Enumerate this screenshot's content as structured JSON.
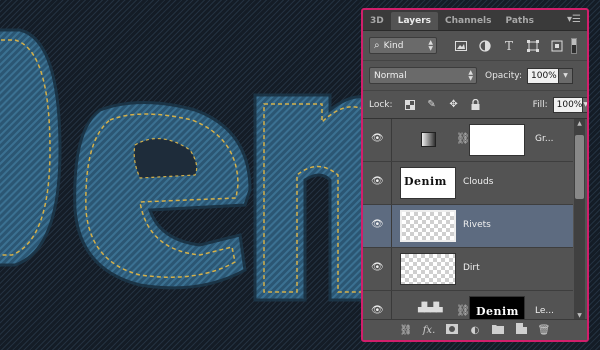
{
  "tabs": [
    {
      "label": "3D",
      "active": false
    },
    {
      "label": "Layers",
      "active": true
    },
    {
      "label": "Channels",
      "active": false
    },
    {
      "label": "Paths",
      "active": false
    }
  ],
  "filter": {
    "kind_label": "Kind",
    "icons": [
      "image-filter-icon",
      "adjustment-filter-icon",
      "type-filter-icon",
      "shape-filter-icon",
      "smart-object-filter-icon"
    ]
  },
  "blend": {
    "mode": "Normal",
    "opacity_label": "Opacity:",
    "opacity_value": "100%"
  },
  "lock": {
    "label": "Lock:",
    "fill_label": "Fill:",
    "fill_value": "100%"
  },
  "layers": [
    {
      "name": "Gr...",
      "type": "adjustment",
      "selected": false
    },
    {
      "name": "Clouds",
      "type": "image",
      "thumb_text": "Denim",
      "selected": false
    },
    {
      "name": "Rivets",
      "type": "empty",
      "selected": true
    },
    {
      "name": "Dirt",
      "type": "empty",
      "selected": false
    },
    {
      "name": "Le...",
      "type": "masked",
      "mask_text": "Denim",
      "selected": false
    }
  ],
  "bottom_icons": [
    "link-layers-icon",
    "fx-icon",
    "add-mask-icon",
    "new-adjustment-icon",
    "new-group-icon",
    "new-layer-icon",
    "trash-icon"
  ],
  "colors": {
    "accent_border": "#d11f6b",
    "panel_bg": "#535353",
    "selected_row": "#5d6b80",
    "denim": "#2f5c7c"
  }
}
